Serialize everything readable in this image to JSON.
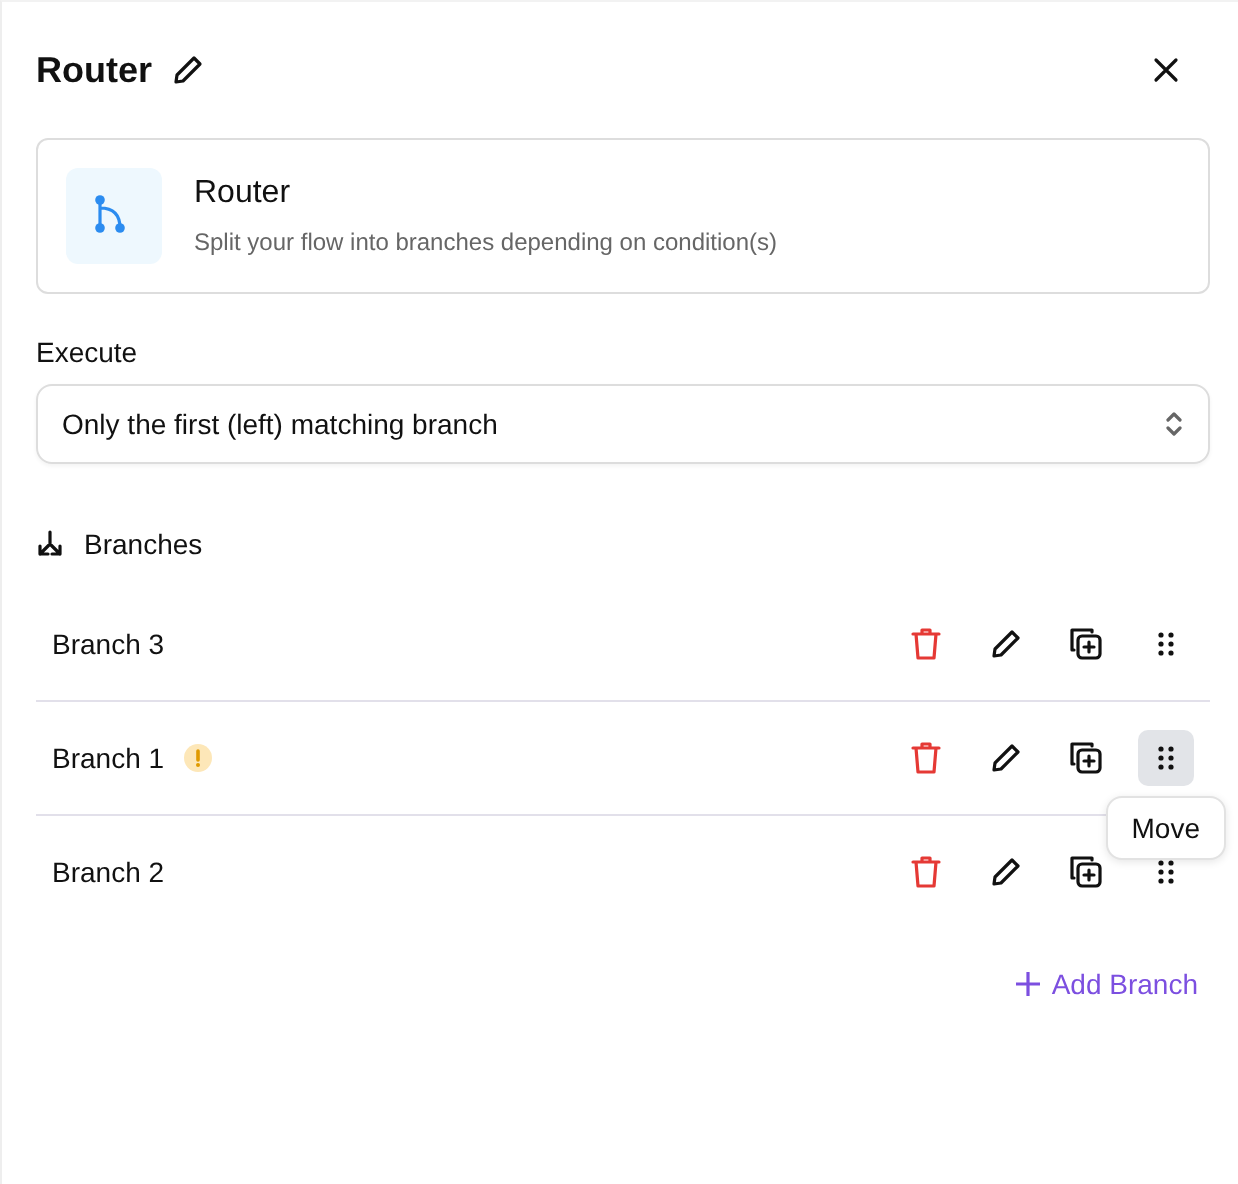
{
  "header": {
    "title": "Router"
  },
  "card": {
    "title": "Router",
    "description": "Split your flow into branches depending on condition(s)"
  },
  "execute": {
    "label": "Execute",
    "value": "Only the first (left) matching branch"
  },
  "branches_heading": "Branches",
  "branches": [
    {
      "name": "Branch 3",
      "warning": false,
      "move_hovered": false
    },
    {
      "name": "Branch 1",
      "warning": true,
      "move_hovered": true,
      "tooltip": "Move"
    },
    {
      "name": "Branch 2",
      "warning": false,
      "move_hovered": false
    }
  ],
  "add_button": "Add Branch"
}
